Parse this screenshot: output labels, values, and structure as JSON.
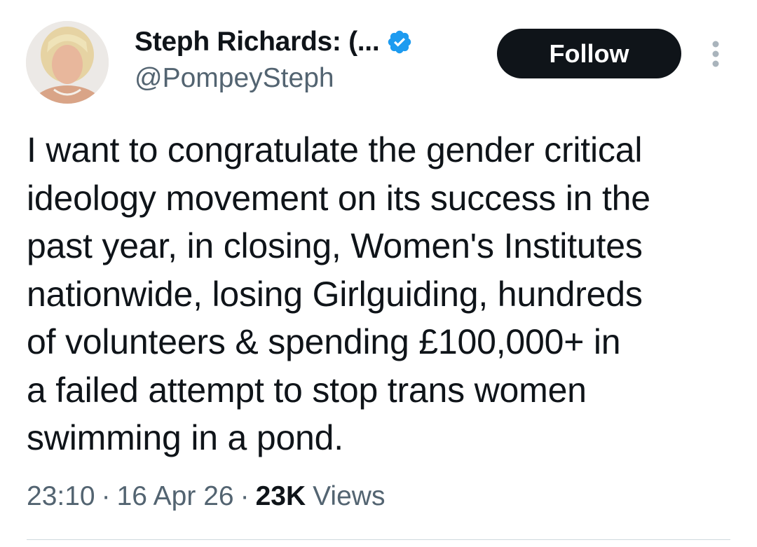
{
  "author": {
    "display_name": "Steph Richards: (...",
    "handle": "@PompeySteph",
    "verified": true
  },
  "follow_button": {
    "label": "Follow"
  },
  "tweet": {
    "text": "I want to congratulate the gender critical\nideology movement on its success in the\npast year, in closing, Women's Institutes\nnationwide, losing Girlguiding, hundreds\nof volunteers & spending £100,000+ in\na failed attempt to stop trans women\nswimming in a pond.",
    "time": "23:10",
    "date": "16 Apr 26",
    "views_count": "23K",
    "views_label": "Views",
    "separator": "·"
  },
  "colors": {
    "text_primary": "#0f1419",
    "text_secondary": "#536471",
    "verified_blue": "#1d9bf0",
    "follow_bg": "#0f1419"
  },
  "icons": {
    "verified": "verified-badge-icon",
    "more": "more-vertical-icon"
  }
}
